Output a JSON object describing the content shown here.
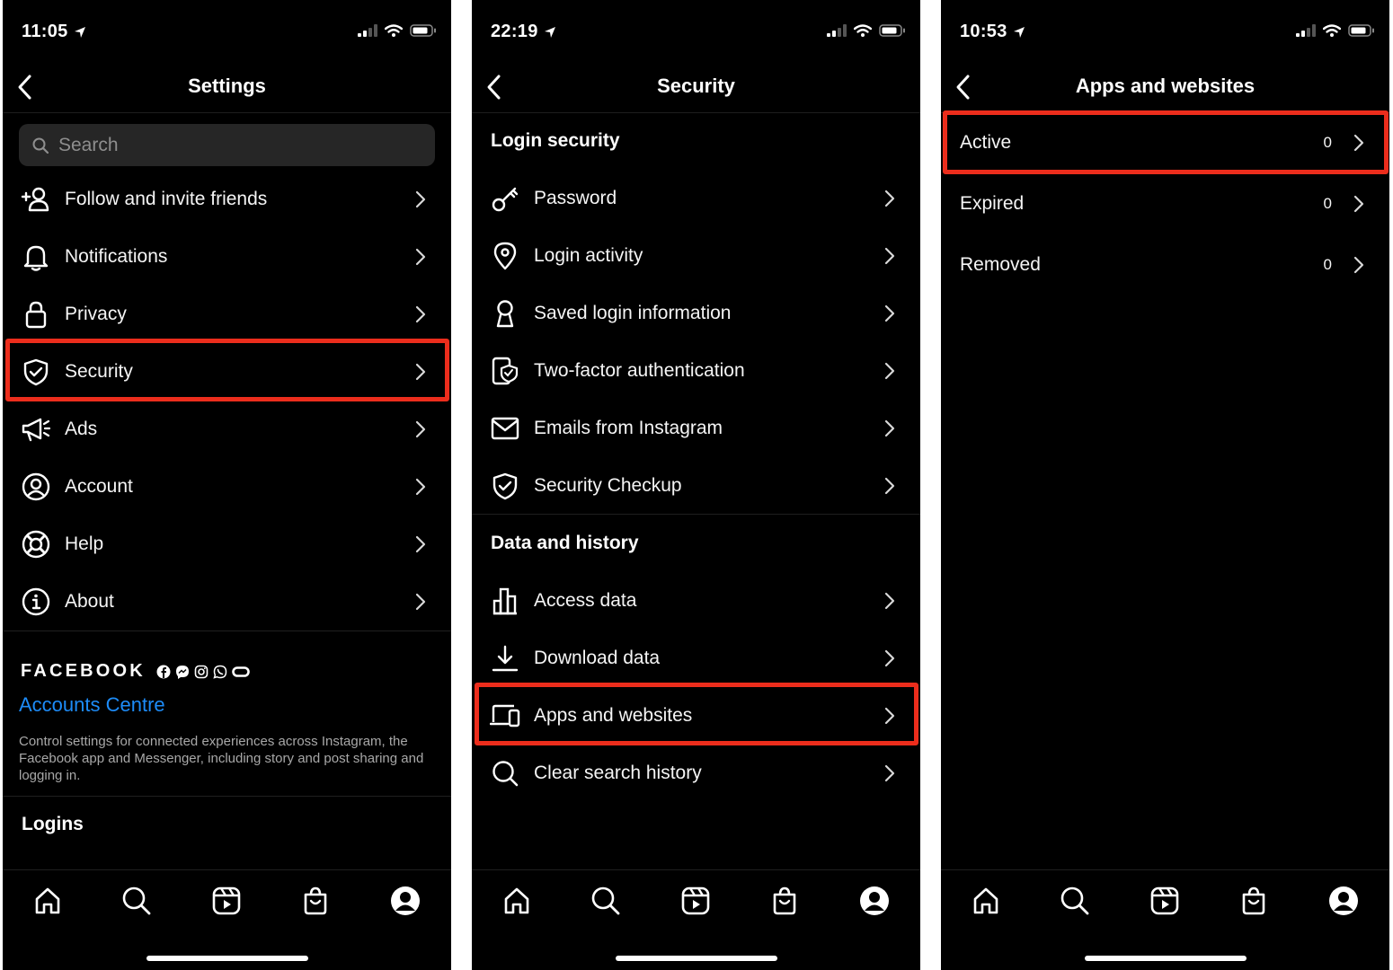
{
  "screens": [
    {
      "time": "11:05",
      "title": "Settings",
      "search_placeholder": "Search",
      "items": [
        {
          "label": "Follow and invite friends",
          "icon": "add-person-icon"
        },
        {
          "label": "Notifications",
          "icon": "bell-icon"
        },
        {
          "label": "Privacy",
          "icon": "lock-icon"
        },
        {
          "label": "Security",
          "icon": "shield-icon"
        },
        {
          "label": "Ads",
          "icon": "megaphone-icon"
        },
        {
          "label": "Account",
          "icon": "account-circle-icon"
        },
        {
          "label": "Help",
          "icon": "lifebuoy-icon"
        },
        {
          "label": "About",
          "icon": "info-icon"
        }
      ],
      "brand": "FACEBOOK",
      "accounts_centre": "Accounts Centre",
      "description": "Control settings for connected experiences across Instagram, the Facebook app and Messenger, including story and post sharing and logging in.",
      "logins_header": "Logins"
    },
    {
      "time": "22:19",
      "title": "Security",
      "sections": [
        {
          "header": "Login security",
          "items": [
            {
              "label": "Password",
              "icon": "key-icon"
            },
            {
              "label": "Login activity",
              "icon": "location-pin-icon"
            },
            {
              "label": "Saved login information",
              "icon": "keyhole-icon"
            },
            {
              "label": "Two-factor authentication",
              "icon": "device-shield-icon"
            },
            {
              "label": "Emails from Instagram",
              "icon": "envelope-icon"
            },
            {
              "label": "Security Checkup",
              "icon": "shield-check-icon"
            }
          ]
        },
        {
          "header": "Data and history",
          "items": [
            {
              "label": "Access data",
              "icon": "bar-chart-icon"
            },
            {
              "label": "Download data",
              "icon": "download-icon"
            },
            {
              "label": "Apps and websites",
              "icon": "laptop-phone-icon"
            },
            {
              "label": "Clear search history",
              "icon": "search-icon"
            }
          ]
        }
      ]
    },
    {
      "time": "10:53",
      "title": "Apps and websites",
      "items": [
        {
          "label": "Active",
          "count": "0"
        },
        {
          "label": "Expired",
          "count": "0"
        },
        {
          "label": "Removed",
          "count": "0"
        }
      ]
    }
  ],
  "tabs": [
    "home-icon",
    "search-icon",
    "reels-icon",
    "shop-icon",
    "profile-icon"
  ],
  "colors": {
    "background": "#000000",
    "highlight": "#ec2d1c",
    "link": "#1d8cf8",
    "text": "#f5f5f5"
  }
}
